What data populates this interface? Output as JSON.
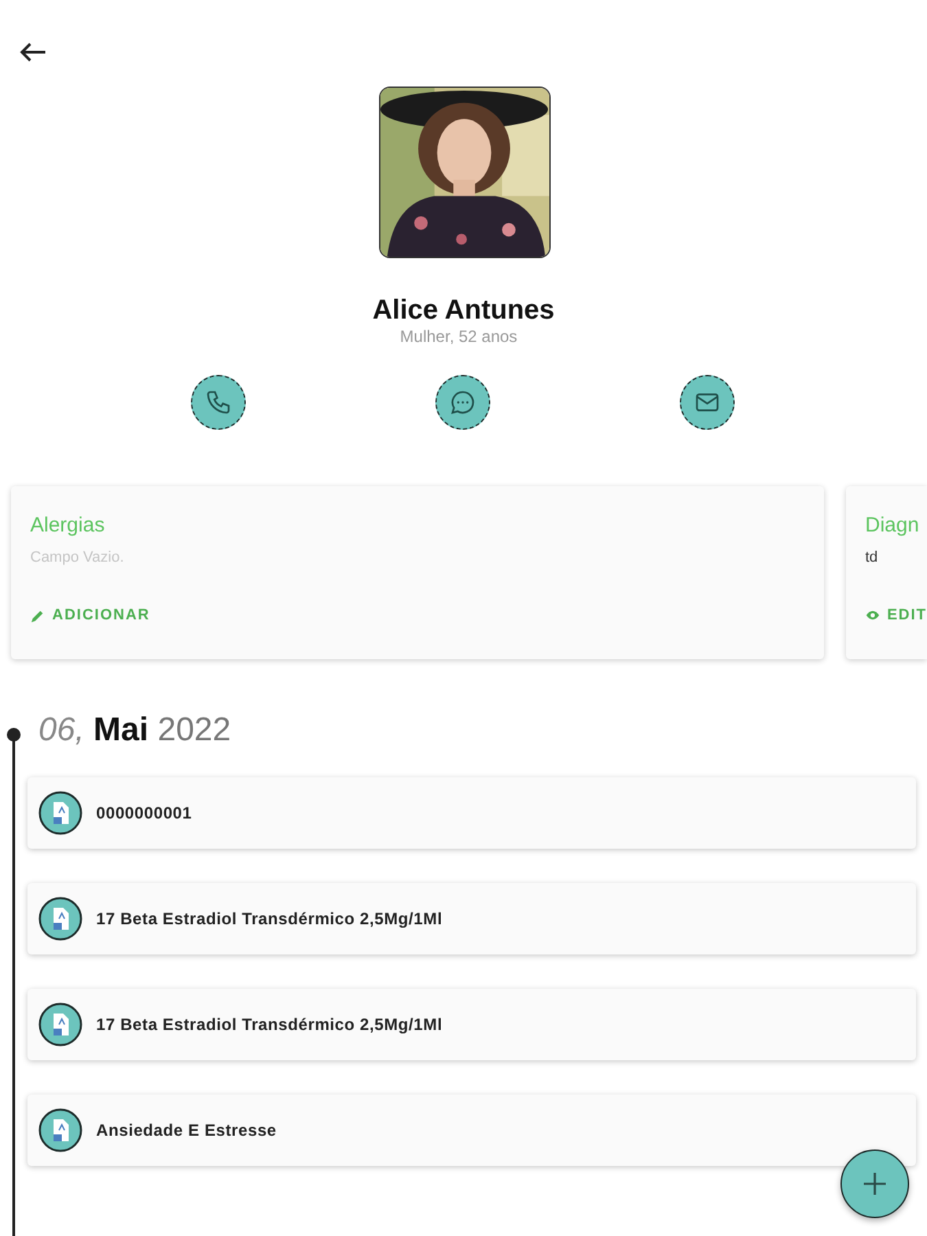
{
  "profile": {
    "name": "Alice Antunes",
    "subtitle": "Mulher, 52 anos"
  },
  "contact_actions": [
    {
      "kind": "phone"
    },
    {
      "kind": "message"
    },
    {
      "kind": "email"
    }
  ],
  "info_cards": [
    {
      "title": "Alergias",
      "body": "Campo Vazio.",
      "empty": true,
      "action": {
        "kind": "add",
        "label": "ADICIONAR"
      }
    },
    {
      "title": "Diagn",
      "body": "td",
      "empty": false,
      "action": {
        "kind": "view",
        "label": "EDIT"
      }
    }
  ],
  "timeline": {
    "day": "06,",
    "month": "Mai",
    "year": "2022",
    "entries": [
      {
        "title": "0000000001"
      },
      {
        "title": "17 Beta Estradiol Transdérmico 2,5Mg/1Ml"
      },
      {
        "title": "17 Beta Estradiol Transdérmico 2,5Mg/1Ml"
      },
      {
        "title": "Ansiedade E Estresse"
      }
    ]
  }
}
